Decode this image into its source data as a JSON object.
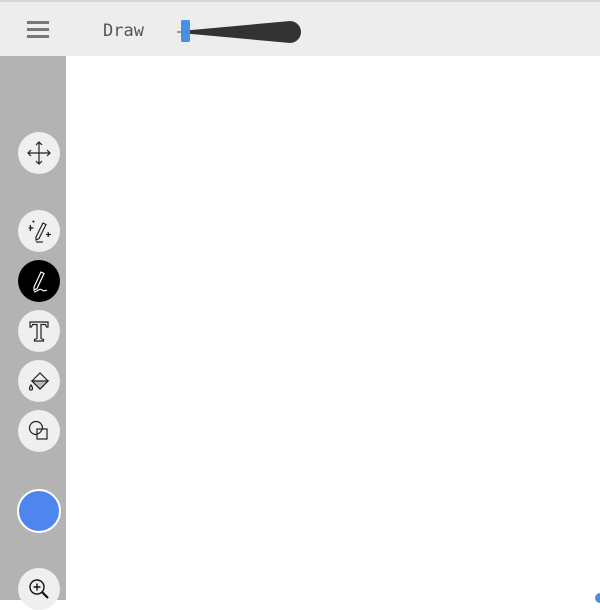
{
  "header": {
    "title": "Draw",
    "menu_icon": "hamburger-menu-icon",
    "stroke_width_slider": {
      "value_percent": 5
    }
  },
  "tools": [
    {
      "name": "move",
      "icon": "move-arrows-icon",
      "active": false
    },
    {
      "name": "magic-pen",
      "icon": "sparkle-pen-icon",
      "active": false
    },
    {
      "name": "pen",
      "icon": "pen-icon",
      "active": true
    },
    {
      "name": "text",
      "icon": "text-t-icon",
      "active": false
    },
    {
      "name": "fill",
      "icon": "paint-bucket-icon",
      "active": false
    },
    {
      "name": "shapes",
      "icon": "shapes-icon",
      "active": false
    }
  ],
  "color": {
    "current": "#4f86ee"
  },
  "zoom": {
    "icon": "zoom-in-icon"
  },
  "colors": {
    "accent": "#4a90e2",
    "sidebar": "#b3b3b3",
    "topbar": "#ededed"
  }
}
